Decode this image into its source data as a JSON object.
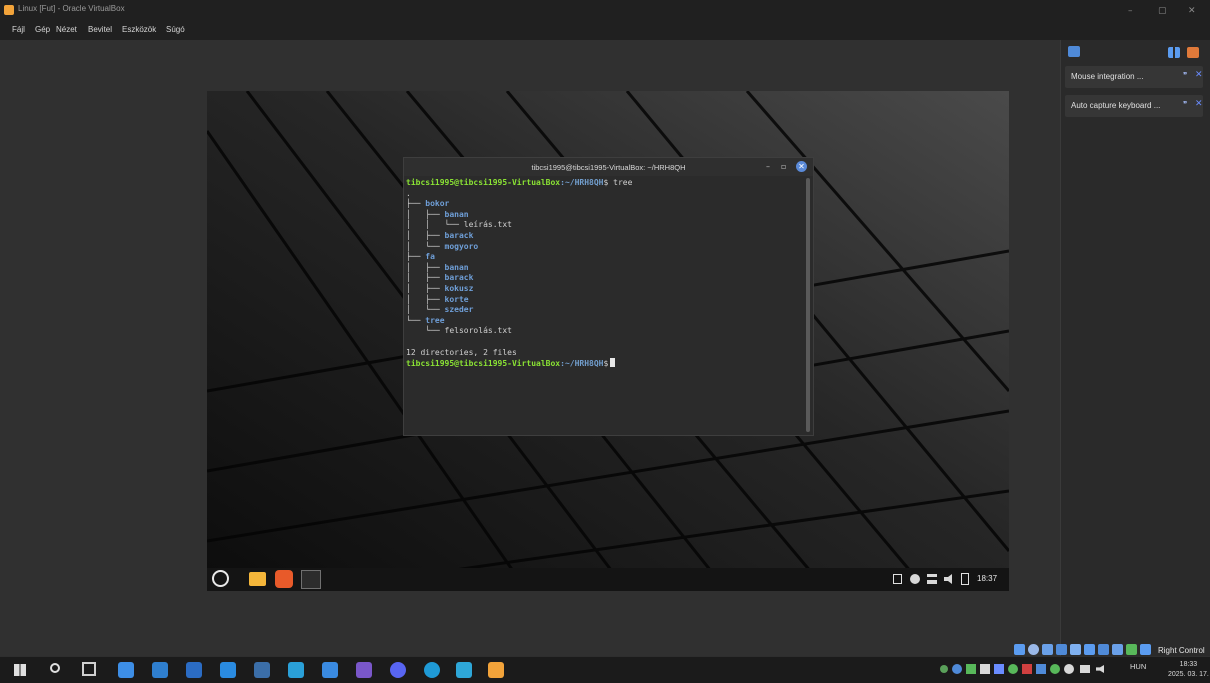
{
  "window": {
    "title": "Linux [Fut] - Oracle VirtualBox",
    "controls": [
      "–",
      "▢",
      "✕"
    ]
  },
  "menubar": {
    "items": [
      "Fájl",
      "Gép",
      "Nézet",
      "Bevitel",
      "Eszközök",
      "Súgó"
    ]
  },
  "side_panel": {
    "notifications": [
      {
        "label": "Mouse integration ..."
      },
      {
        "label": "Auto capture keyboard ..."
      }
    ]
  },
  "terminal": {
    "title": "tibcsi1995@tibcsi1995-VirtualBox: ~/HRH8QH",
    "prompt_user": "tibcsi1995@tibcsi1995-VirtualBox",
    "prompt_path": ":~/HRH8QH",
    "prompt_symbol": "$",
    "command": " tree",
    "tree": [
      {
        "prefix": ".",
        "name": "",
        "type": "plain"
      },
      {
        "prefix": "├── ",
        "name": "bokor",
        "type": "dir"
      },
      {
        "prefix": "│   ├── ",
        "name": "banan",
        "type": "dir"
      },
      {
        "prefix": "│   │   └── ",
        "name": "leírás.txt",
        "type": "plain"
      },
      {
        "prefix": "│   ├── ",
        "name": "barack",
        "type": "dir"
      },
      {
        "prefix": "│   └── ",
        "name": "mogyoro",
        "type": "dir"
      },
      {
        "prefix": "├── ",
        "name": "fa",
        "type": "dir"
      },
      {
        "prefix": "│   ├── ",
        "name": "banan",
        "type": "dir"
      },
      {
        "prefix": "│   ├── ",
        "name": "barack",
        "type": "dir"
      },
      {
        "prefix": "│   ├── ",
        "name": "kokusz",
        "type": "dir"
      },
      {
        "prefix": "│   ├── ",
        "name": "korte",
        "type": "dir"
      },
      {
        "prefix": "│   └── ",
        "name": "szeder",
        "type": "dir"
      },
      {
        "prefix": "└── ",
        "name": "tree",
        "type": "dir"
      },
      {
        "prefix": "    └── ",
        "name": "felsorolás.txt",
        "type": "plain"
      }
    ],
    "summary": "12 directories, 2 files"
  },
  "guest_panel": {
    "clock": "18:37"
  },
  "host_statusbar": {
    "right_control": "Right Control"
  },
  "taskbar": {
    "language": "HUN",
    "time": "18:33",
    "date": "2025. 03. 17."
  },
  "colors": {
    "prompt_green": "#8ae234",
    "dir_blue": "#6f9fd8",
    "terminal_bg": "#2b2b2b",
    "accent_orange": "#f2a33a"
  }
}
